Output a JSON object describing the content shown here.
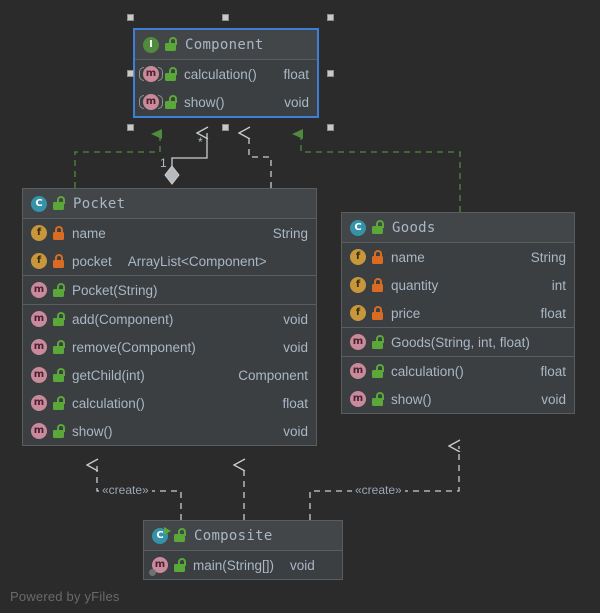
{
  "diagram": {
    "title": "UML Class Diagram",
    "background_color": "#2b2b2b",
    "watermark": "Powered by yFiles",
    "selection_color": "#3d7fd4"
  },
  "nodes": {
    "component": {
      "name": "Component",
      "kind": "interface",
      "kind_icon": "interface-icon",
      "visibility": "public",
      "visibility_icon": "unlock-icon",
      "selected": true,
      "members": [
        {
          "icon": "method-abstract-icon",
          "visibility_icon": "unlock-icon",
          "visibility": "public",
          "name": "calculation()",
          "type": "float"
        },
        {
          "icon": "method-abstract-icon",
          "visibility_icon": "unlock-icon",
          "visibility": "public",
          "name": "show()",
          "type": "void"
        }
      ]
    },
    "pocket": {
      "name": "Pocket",
      "kind": "class",
      "kind_icon": "class-icon",
      "visibility": "public",
      "visibility_icon": "unlock-icon",
      "selected": false,
      "fields": [
        {
          "icon": "field-icon",
          "visibility_icon": "lock-icon",
          "visibility": "private",
          "name": "name",
          "type": "String"
        },
        {
          "icon": "field-icon",
          "visibility_icon": "lock-icon",
          "visibility": "private",
          "name": "pocket",
          "type": "ArrayList<Component>"
        }
      ],
      "constructors": [
        {
          "icon": "method-icon",
          "visibility_icon": "unlock-icon",
          "visibility": "public",
          "name": "Pocket(String)",
          "type": ""
        }
      ],
      "methods": [
        {
          "icon": "method-icon",
          "visibility_icon": "unlock-icon",
          "visibility": "public",
          "name": "add(Component)",
          "type": "void"
        },
        {
          "icon": "method-icon",
          "visibility_icon": "unlock-icon",
          "visibility": "public",
          "name": "remove(Component)",
          "type": "void"
        },
        {
          "icon": "method-icon",
          "visibility_icon": "unlock-icon",
          "visibility": "public",
          "name": "getChild(int)",
          "type": "Component"
        },
        {
          "icon": "method-icon",
          "visibility_icon": "unlock-icon",
          "visibility": "public",
          "name": "calculation()",
          "type": "float"
        },
        {
          "icon": "method-icon",
          "visibility_icon": "unlock-icon",
          "visibility": "public",
          "name": "show()",
          "type": "void"
        }
      ]
    },
    "goods": {
      "name": "Goods",
      "kind": "class",
      "kind_icon": "class-icon",
      "visibility": "public",
      "visibility_icon": "unlock-icon",
      "selected": false,
      "fields": [
        {
          "icon": "field-icon",
          "visibility_icon": "lock-icon",
          "visibility": "private",
          "name": "name",
          "type": "String"
        },
        {
          "icon": "field-icon",
          "visibility_icon": "lock-icon",
          "visibility": "private",
          "name": "quantity",
          "type": "int"
        },
        {
          "icon": "field-icon",
          "visibility_icon": "lock-icon",
          "visibility": "private",
          "name": "price",
          "type": "float"
        }
      ],
      "constructors": [
        {
          "icon": "method-icon",
          "visibility_icon": "unlock-icon",
          "visibility": "public",
          "name": "Goods(String, int, float)",
          "type": ""
        }
      ],
      "methods": [
        {
          "icon": "method-icon",
          "visibility_icon": "unlock-icon",
          "visibility": "public",
          "name": "calculation()",
          "type": "float"
        },
        {
          "icon": "method-icon",
          "visibility_icon": "unlock-icon",
          "visibility": "public",
          "name": "show()",
          "type": "void"
        }
      ]
    },
    "composite": {
      "name": "Composite",
      "kind": "runnable-class",
      "kind_icon": "runnable-class-icon",
      "visibility": "public",
      "visibility_icon": "unlock-icon",
      "selected": false,
      "methods": [
        {
          "icon": "main-method-icon",
          "visibility_icon": "unlock-icon",
          "visibility": "public",
          "name": "main(String[])",
          "type": "void"
        }
      ]
    }
  },
  "edges": {
    "realization_color": "#4f8a3d",
    "association_color": "#c9ccce",
    "dependency_color": "#c9ccce",
    "pocket_realizes_component": {
      "type": "realization",
      "source": "Pocket",
      "target": "Component",
      "style": "dashed",
      "arrow": "solid-triangle"
    },
    "goods_realizes_component": {
      "type": "realization",
      "source": "Goods",
      "target": "Component",
      "style": "dashed",
      "arrow": "solid-triangle"
    },
    "pocket_aggregates_component": {
      "type": "aggregation",
      "source": "Pocket",
      "target": "Component",
      "style": "solid",
      "arrow": "open-arrow",
      "source_multiplicity": "1",
      "target_multiplicity": "*"
    },
    "pocket_depends_component": {
      "type": "dependency",
      "source": "Pocket",
      "target": "Component",
      "style": "dashed",
      "arrow": "open-arrow"
    },
    "composite_creates_pocket": {
      "type": "dependency",
      "source": "Composite",
      "target": "Pocket",
      "style": "dashed",
      "arrow": "open-arrow",
      "label": "«create»"
    },
    "composite_uses_pocket": {
      "type": "dependency",
      "source": "Composite",
      "target": "Pocket",
      "style": "dashed",
      "arrow": "open-arrow",
      "label": ""
    },
    "composite_creates_goods": {
      "type": "dependency",
      "source": "Composite",
      "target": "Goods",
      "style": "dashed",
      "arrow": "open-arrow",
      "label": "«create»"
    }
  }
}
